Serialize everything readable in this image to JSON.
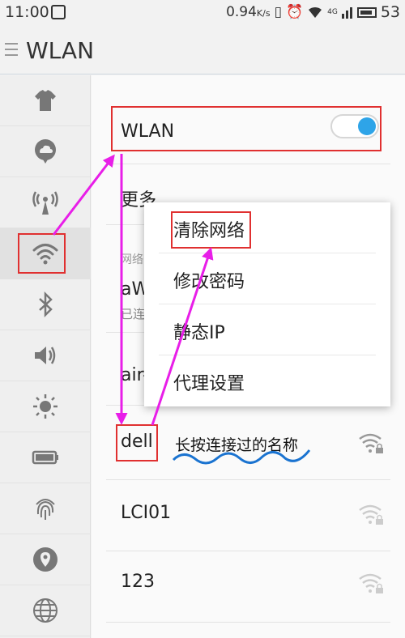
{
  "status_bar": {
    "time": "11:00",
    "speed": "0.94",
    "speed_unit": "K/s",
    "network": "4G",
    "battery": "53",
    "icons": [
      "notification-icon",
      "vibrate-icon",
      "alarm-icon",
      "wifi-icon",
      "signal-icon",
      "battery-icon"
    ]
  },
  "header": {
    "title": "WLAN",
    "menu_icon": "menu-icon"
  },
  "sidebar": {
    "items": [
      {
        "name": "theme",
        "icon": "shirt-icon"
      },
      {
        "name": "cloud",
        "icon": "cloud-pin-icon"
      },
      {
        "name": "hotspot",
        "icon": "antenna-icon"
      },
      {
        "name": "wlan",
        "icon": "wifi-icon",
        "active": true
      },
      {
        "name": "bluetooth",
        "icon": "bluetooth-icon"
      },
      {
        "name": "sound",
        "icon": "speaker-icon"
      },
      {
        "name": "display",
        "icon": "brightness-icon"
      },
      {
        "name": "battery",
        "icon": "battery-icon"
      },
      {
        "name": "fingerprint",
        "icon": "fingerprint-icon"
      },
      {
        "name": "location",
        "icon": "location-icon"
      },
      {
        "name": "language",
        "icon": "globe-icon"
      }
    ]
  },
  "main": {
    "wlan_label": "WLAN",
    "wlan_enabled": true,
    "more_label": "更多",
    "section_label": "网络",
    "networks": [
      {
        "ssid": "aW",
        "status": "已连"
      },
      {
        "ssid": "air-"
      },
      {
        "ssid": "dell",
        "secured": true
      },
      {
        "ssid": "LCI01",
        "secured": true
      },
      {
        "ssid": "123",
        "secured": true
      }
    ]
  },
  "popup_menu": {
    "items": [
      "清除网络",
      "修改密码",
      "静态IP",
      "代理设置"
    ]
  },
  "annotation": {
    "note": "长按连接过的名称"
  },
  "colors": {
    "accent": "#2ea4e8",
    "annotation_red": "#e03030",
    "arrow_magenta": "#e81ee8",
    "underline_blue": "#1a73d0"
  }
}
